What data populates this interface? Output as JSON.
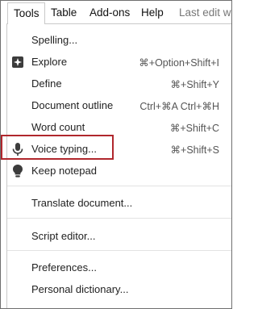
{
  "menubar": {
    "tools": "Tools",
    "table": "Table",
    "addons": "Add-ons",
    "help": "Help",
    "last_edit": "Last edit w"
  },
  "menu": {
    "spelling": {
      "label": "Spelling...",
      "shortcut": ""
    },
    "explore": {
      "label": "Explore",
      "shortcut": "⌘+Option+Shift+I"
    },
    "define": {
      "label": "Define",
      "shortcut": "⌘+Shift+Y"
    },
    "outline": {
      "label": "Document outline",
      "shortcut": "Ctrl+⌘A Ctrl+⌘H"
    },
    "word_count": {
      "label": "Word count",
      "shortcut": "⌘+Shift+C"
    },
    "voice": {
      "label": "Voice typing...",
      "shortcut": "⌘+Shift+S"
    },
    "keep": {
      "label": "Keep notepad",
      "shortcut": ""
    },
    "translate": {
      "label": "Translate document...",
      "shortcut": ""
    },
    "script": {
      "label": "Script editor...",
      "shortcut": ""
    },
    "prefs": {
      "label": "Preferences...",
      "shortcut": ""
    },
    "dictionary": {
      "label": "Personal dictionary...",
      "shortcut": ""
    }
  },
  "colors": {
    "highlight_border": "#b0272d",
    "separator": "#e3e3e3",
    "icon": "#3c3c3c"
  },
  "icons": {
    "explore": "explore-sparkle-icon",
    "voice": "microphone-icon",
    "keep": "lightbulb-icon"
  }
}
